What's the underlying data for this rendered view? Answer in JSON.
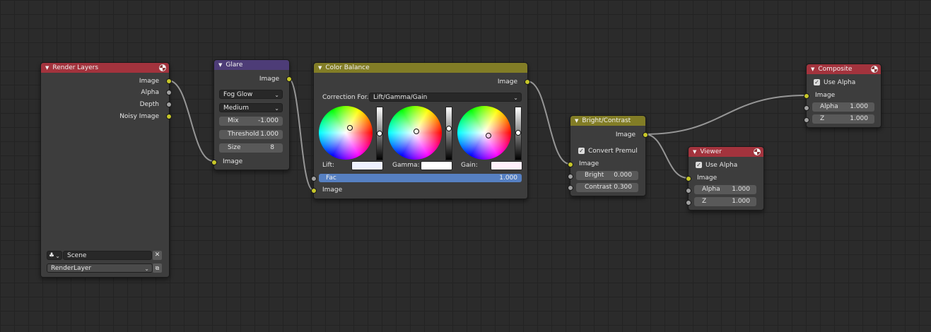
{
  "render_layers": {
    "title": "Render Layers",
    "outputs": [
      "Image",
      "Alpha",
      "Depth",
      "Noisy Image"
    ],
    "scene": "Scene",
    "layer": "RenderLayer"
  },
  "glare": {
    "title": "Glare",
    "output": "Image",
    "type": "Fog Glow",
    "quality": "Medium",
    "mix_label": "Mix",
    "mix_value": "-1.000",
    "threshold_label": "Threshold",
    "threshold_value": "1.000",
    "size_label": "Size",
    "size_value": "8",
    "input": "Image"
  },
  "color_balance": {
    "title": "Color Balance",
    "output": "Image",
    "correction_label": "Correction For..",
    "correction_value": "Lift/Gamma/Gain",
    "lift_label": "Lift:",
    "gamma_label": "Gamma:",
    "gain_label": "Gain:",
    "fac_label": "Fac",
    "fac_value": "1.000",
    "input": "Image",
    "fac_fraction": 1.0
  },
  "bright_contrast": {
    "title": "Bright/Contrast",
    "output": "Image",
    "convert_label": "Convert Premul",
    "input": "Image",
    "bright_label": "Bright",
    "bright_value": "0.000",
    "contrast_label": "Contrast",
    "contrast_value": "0.300"
  },
  "viewer": {
    "title": "Viewer",
    "use_alpha_label": "Use Alpha",
    "input": "Image",
    "alpha_label": "Alpha",
    "alpha_value": "1.000",
    "z_label": "Z",
    "z_value": "1.000"
  },
  "composite": {
    "title": "Composite",
    "use_alpha_label": "Use Alpha",
    "input": "Image",
    "alpha_label": "Alpha",
    "alpha_value": "1.000",
    "z_label": "Z",
    "z_value": "1.000"
  },
  "colors": {
    "input_header": "#a3333d",
    "filter_header": "#4d3c77",
    "color_header": "#827d26",
    "output_header": "#a3333d",
    "image_socket": "#c7c729",
    "value_socket": "#a1a1a1",
    "fac_bar": "#5680c2"
  },
  "icons": {
    "collapse": "triangle-down-icon",
    "sphere": "sphere-preview-icon",
    "scene": "scene-icon",
    "close": "close-icon",
    "render": "render-layer-icon"
  }
}
